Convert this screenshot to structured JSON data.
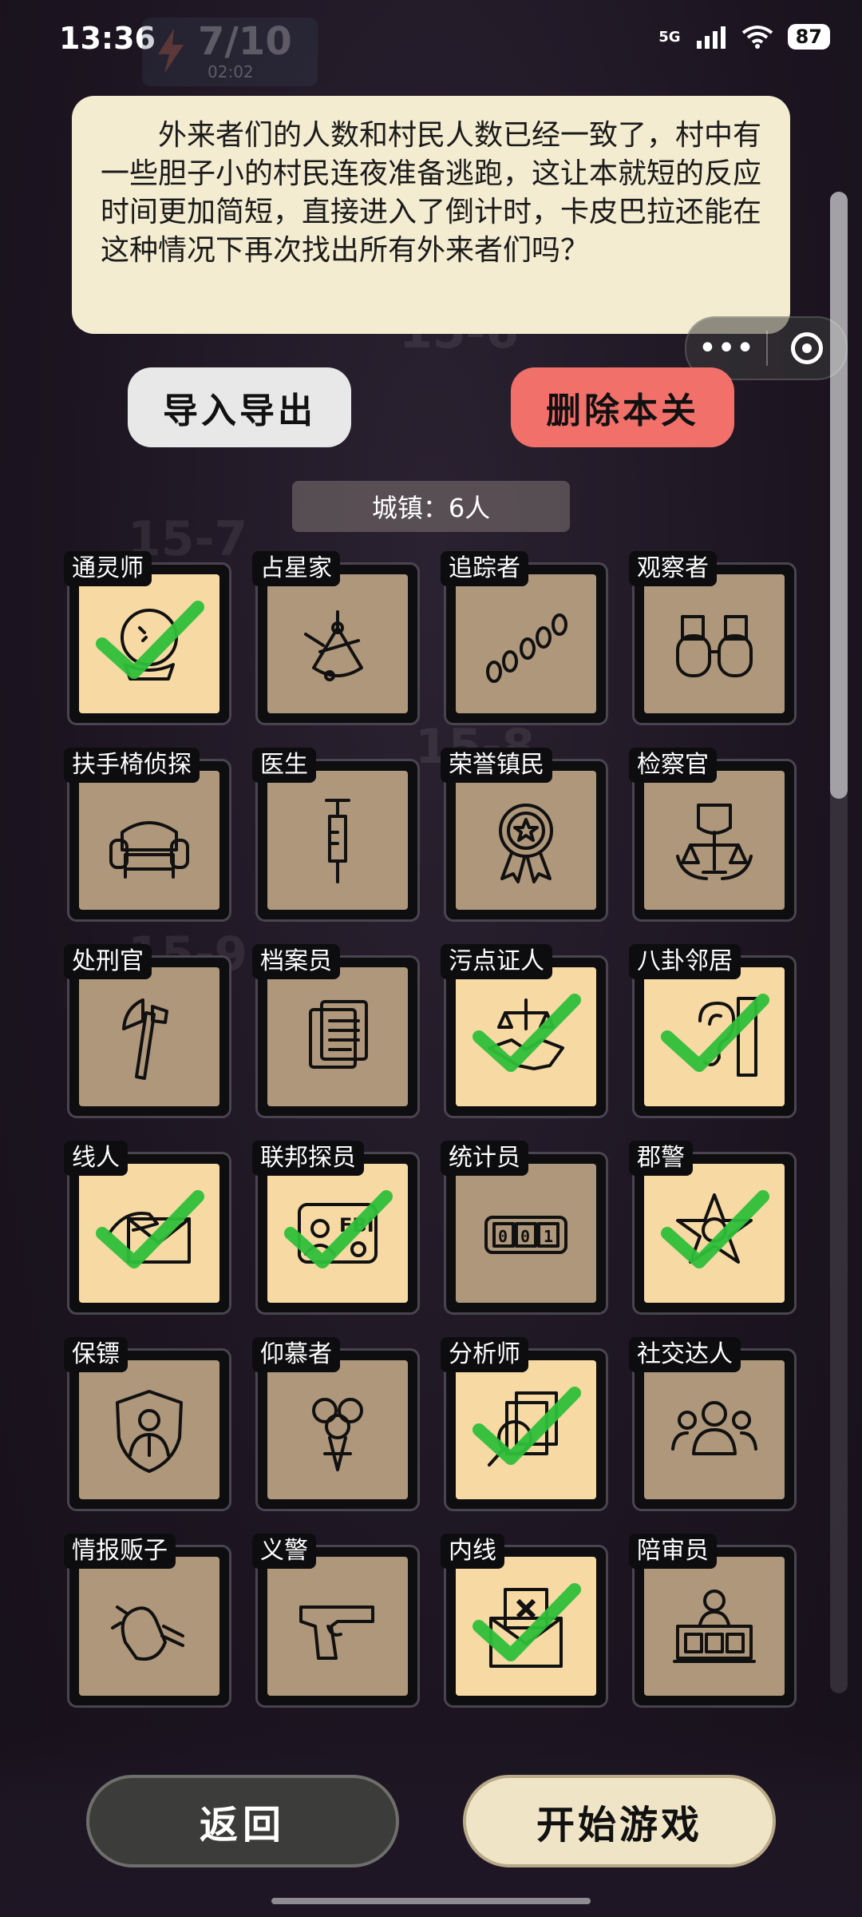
{
  "status_bar": {
    "time": "13:36",
    "network": "5G",
    "battery": "87"
  },
  "hud": {
    "energy": "7/10",
    "timer": "02:02"
  },
  "description": "外来者们的人数和村民人数已经一致了，村中有一些胆子小的村民连夜准备逃跑，这让本就短的反应时间更加简短，直接进入了倒计时，卡皮巴拉还能在这种情况下再次找出所有外来者们吗？",
  "buttons": {
    "import_export": "导入导出",
    "delete_level": "删除本关",
    "back": "返回",
    "start": "开始游戏"
  },
  "town": "城镇：6人",
  "roles": [
    {
      "name": "通灵师",
      "icon": "crystal-ball-icon",
      "selected": true
    },
    {
      "name": "占星家",
      "icon": "sextant-icon",
      "selected": false
    },
    {
      "name": "追踪者",
      "icon": "footprints-icon",
      "selected": false
    },
    {
      "name": "观察者",
      "icon": "binoculars-icon",
      "selected": false
    },
    {
      "name": "扶手椅侦探",
      "icon": "armchair-icon",
      "selected": false
    },
    {
      "name": "医生",
      "icon": "syringe-icon",
      "selected": false
    },
    {
      "name": "荣誉镇民",
      "icon": "medal-icon",
      "selected": false
    },
    {
      "name": "检察官",
      "icon": "scales-shield-icon",
      "selected": false
    },
    {
      "name": "处刑官",
      "icon": "axe-icon",
      "selected": false
    },
    {
      "name": "档案员",
      "icon": "documents-icon",
      "selected": false
    },
    {
      "name": "污点证人",
      "icon": "handshake-scales-icon",
      "selected": true
    },
    {
      "name": "八卦邻居",
      "icon": "ear-door-icon",
      "selected": true
    },
    {
      "name": "线人",
      "icon": "envelope-hand-icon",
      "selected": true
    },
    {
      "name": "联邦探员",
      "icon": "fbi-badge-icon",
      "selected": true
    },
    {
      "name": "统计员",
      "icon": "counter-icon",
      "selected": false
    },
    {
      "name": "郡警",
      "icon": "sheriff-star-icon",
      "selected": true
    },
    {
      "name": "保镖",
      "icon": "bodyguard-shield-icon",
      "selected": false
    },
    {
      "name": "仰慕者",
      "icon": "roses-icon",
      "selected": false
    },
    {
      "name": "分析师",
      "icon": "magnifier-docs-icon",
      "selected": true
    },
    {
      "name": "社交达人",
      "icon": "people-group-icon",
      "selected": false
    },
    {
      "name": "情报贩子",
      "icon": "whisper-hand-icon",
      "selected": false
    },
    {
      "name": "义警",
      "icon": "pistol-icon",
      "selected": false
    },
    {
      "name": "内线",
      "icon": "envelope-x-icon",
      "selected": true
    },
    {
      "name": "陪审员",
      "icon": "jury-bench-icon",
      "selected": false
    }
  ],
  "colors": {
    "selected_card": "#f7d9a3",
    "unselected_card": "#ae977a",
    "check": "#2fbf3a",
    "delete_button": "#f2706a"
  }
}
